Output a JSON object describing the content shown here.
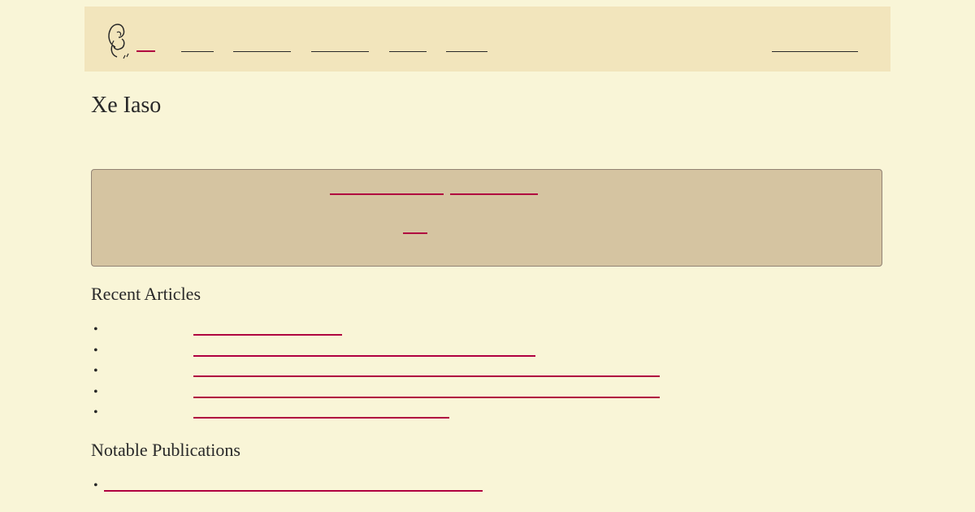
{
  "site": {
    "title": "Xe Iaso"
  },
  "sections": {
    "recent_articles": "Recent Articles",
    "notable_publications": "Notable Publications"
  },
  "colors": {
    "page_background": "#f9f5d7",
    "header_background": "#f2e5bc",
    "notice_background": "#d5c4a1",
    "link": "#b00040",
    "text": "#282828"
  },
  "icons": {
    "logo": "character-sketch-logo-icon"
  }
}
